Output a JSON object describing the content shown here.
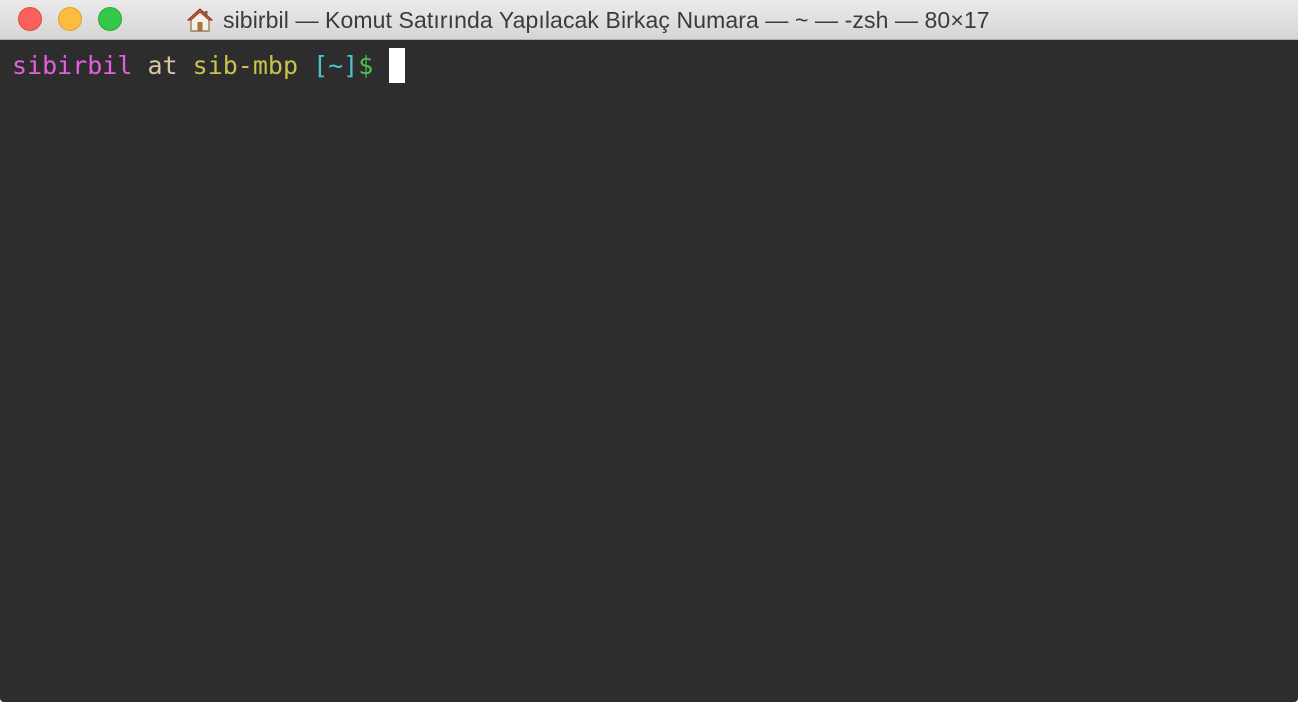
{
  "window": {
    "title": "sibirbil — Komut Satırında Yapılacak Birkaç Numara — ~ — -zsh — 80×17",
    "title_icon": "home-icon",
    "traffic_lights": {
      "close_color": "#fc605c",
      "minimize_color": "#fdbc40",
      "zoom_color": "#34c84a"
    }
  },
  "terminal": {
    "background": "#2d2d2d",
    "prompt": {
      "user": "sibirbil",
      "at": " at ",
      "host": "sib-mbp",
      "space": " ",
      "cwd": "[~]",
      "symbol": "$",
      "colors": {
        "user": "#e75de0",
        "at": "#d8c9a0",
        "host": "#c9c34a",
        "cwd": "#4fc3d0",
        "symbol": "#4dc24f"
      }
    }
  }
}
